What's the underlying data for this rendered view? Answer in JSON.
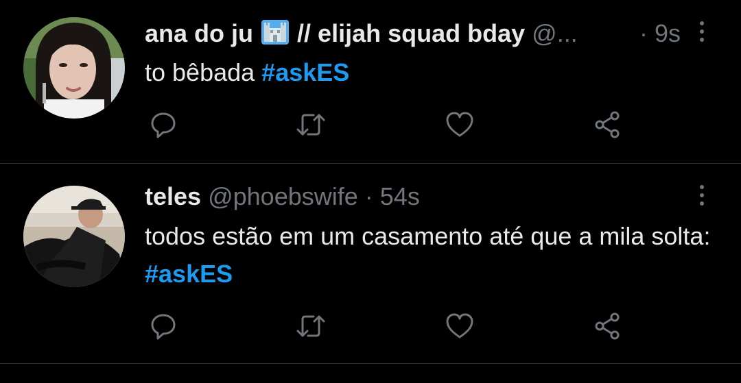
{
  "theme": {
    "background": "#000000",
    "text": "#e7e9ea",
    "muted": "#71767b",
    "accent": "#1d9bf0",
    "divider": "#2f3336"
  },
  "tweets": [
    {
      "display_name": "ana do ju",
      "name_emoji": "castle-icon",
      "name_suffix": "// elijah squad bday",
      "handle": "@...",
      "separator": "·",
      "time": "9s",
      "text": "to bêbada",
      "hashtag": "#askES",
      "actions": [
        "reply-icon",
        "retweet-icon",
        "like-icon",
        "share-icon"
      ]
    },
    {
      "display_name": "teles",
      "handle": "@phoebswife",
      "separator": "·",
      "time": "54s",
      "text": "todos estão em um casamento até que a mila solta:",
      "hashtag": "#askES",
      "actions": [
        "reply-icon",
        "retweet-icon",
        "like-icon",
        "share-icon"
      ]
    }
  ]
}
